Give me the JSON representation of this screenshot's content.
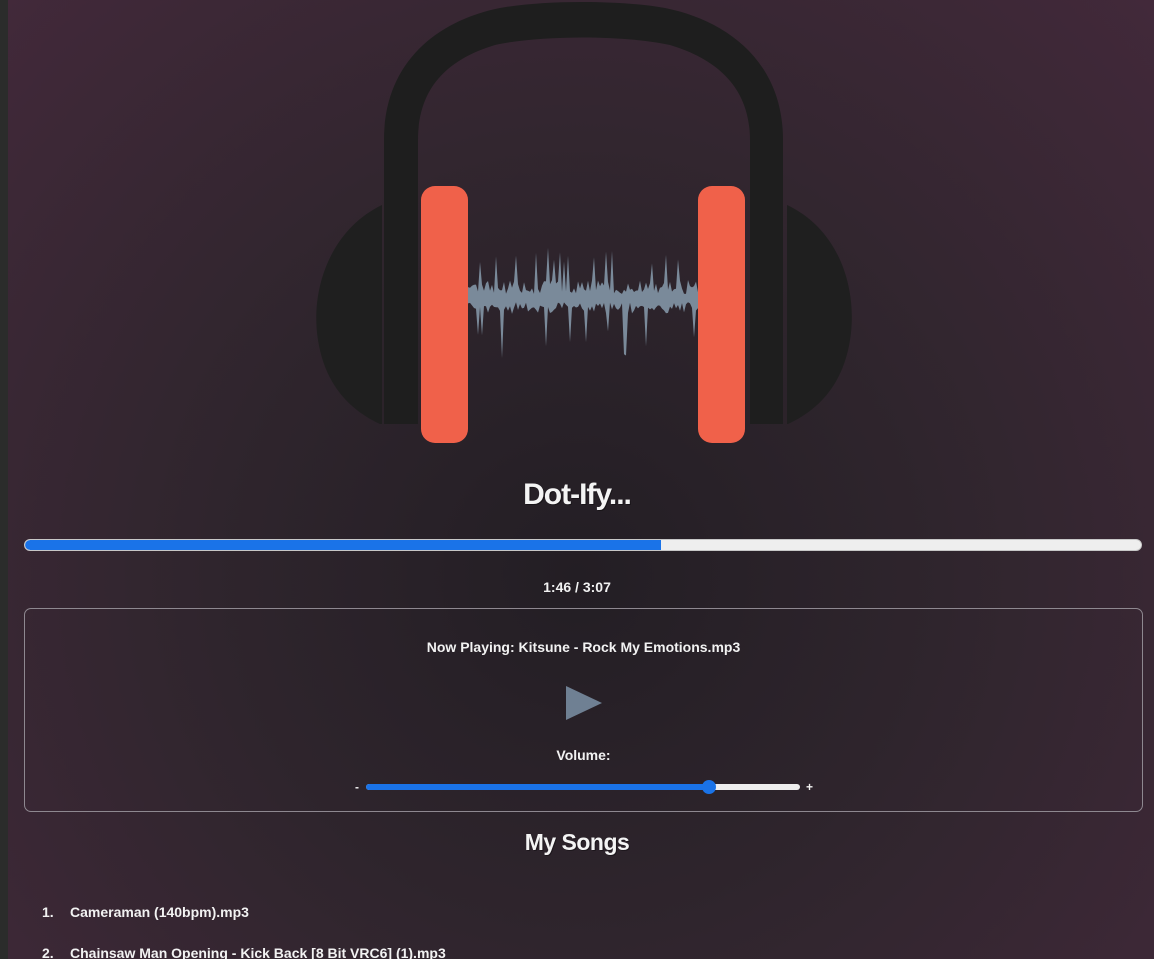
{
  "app": {
    "title": "Dot-Ify..."
  },
  "player": {
    "progress_fraction": 0.57,
    "time_readout": "1:46 / 3:07",
    "now_playing": "Now Playing: Kitsune - Rock My Emotions.mp3",
    "play_icon": "play-icon",
    "volume_label": "Volume:",
    "volume_min_label": "-",
    "volume_max_label": "+",
    "volume_fraction": 0.79
  },
  "songs": {
    "heading": "My Songs",
    "items": [
      {
        "number": "1.",
        "title": "Cameraman (140bpm).mp3"
      },
      {
        "number": "2.",
        "title": "Chainsaw Man Opening - Kick Back [8 Bit VRC6] (1).mp3"
      }
    ]
  },
  "colors": {
    "accent": "#1a73e8",
    "ear_cup": "#f0614a",
    "headphone_body": "#1e1e1e",
    "waveform": "#7a8a9a",
    "play_icon": "#6f8093",
    "background": "#2f252d"
  }
}
